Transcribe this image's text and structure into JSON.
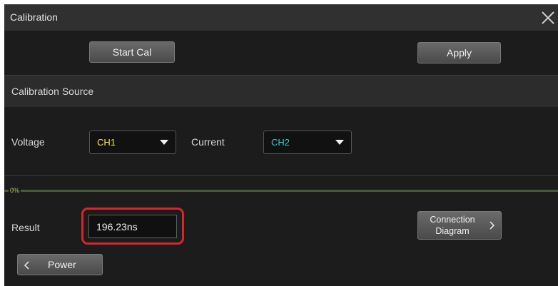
{
  "dialog": {
    "title": "Calibration",
    "close_icon": "close-x-icon"
  },
  "actions": {
    "start_cal_label": "Start Cal",
    "apply_label": "Apply"
  },
  "source": {
    "header": "Calibration Source",
    "voltage_label": "Voltage",
    "voltage_value": "CH1",
    "current_label": "Current",
    "current_value": "CH2"
  },
  "progress": {
    "label": "0%",
    "percent": 0
  },
  "result": {
    "label": "Result",
    "value": "196.23ns"
  },
  "connection": {
    "line1": "Connection",
    "line2": "Diagram",
    "icon": "chevron-right-icon"
  },
  "nav": {
    "power_label": "Power",
    "icon": "chevron-left-icon"
  },
  "colors": {
    "ch1": "#f2e94e",
    "ch2": "#29d3d6",
    "progress": "#b3d048",
    "highlight": "#d9252a"
  }
}
